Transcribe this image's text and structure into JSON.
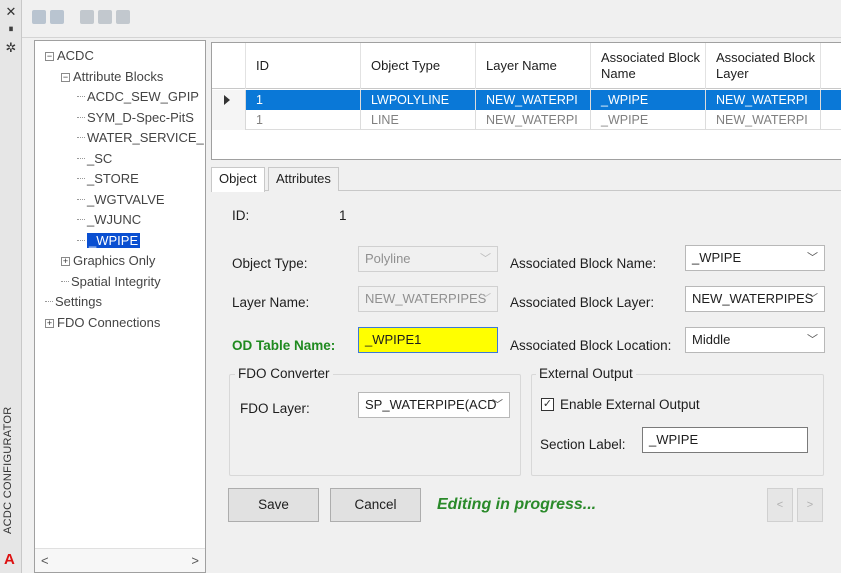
{
  "palette": {
    "title": "ACDC CONFIGURATOR",
    "close_glyph": "✕",
    "pin_glyph": "⏸",
    "settings_glyph": "✲"
  },
  "tree": {
    "items": [
      {
        "label": "ACDC",
        "expander": "−",
        "indent": 0
      },
      {
        "label": "Attribute Blocks",
        "expander": "−",
        "indent": 1
      },
      {
        "label": "ACDC_SEW_GPIP",
        "indent": 2
      },
      {
        "label": "SYM_D-Spec-PitS",
        "indent": 2
      },
      {
        "label": "WATER_SERVICE_",
        "indent": 2
      },
      {
        "label": "_SC",
        "indent": 2
      },
      {
        "label": "_STORE",
        "indent": 2
      },
      {
        "label": "_WGTVALVE",
        "indent": 2
      },
      {
        "label": "_WJUNC",
        "indent": 2
      },
      {
        "label": "_WPIPE",
        "indent": 2,
        "selected": true
      },
      {
        "label": "Graphics Only",
        "expander": "+",
        "indent": 1
      },
      {
        "label": "Spatial Integrity",
        "indent": 1
      },
      {
        "label": "Settings",
        "indent": 0
      },
      {
        "label": "FDO Connections",
        "expander": "+",
        "indent": 0
      }
    ],
    "scroll_left": "<",
    "scroll_right": ">"
  },
  "grid": {
    "headers": [
      "ID",
      "Object Type",
      "Layer Name",
      "Associated Block Name",
      "Associated Block Layer"
    ],
    "rows": [
      [
        "1",
        "LWPOLYLINE",
        "NEW_WATERPI",
        "_WPIPE",
        "NEW_WATERPI"
      ],
      [
        "1",
        "LINE",
        "NEW_WATERPI",
        "_WPIPE",
        "NEW_WATERPI"
      ]
    ]
  },
  "tabs": [
    "Object",
    "Attributes"
  ],
  "form": {
    "id_label": "ID:",
    "id_value": "1",
    "object_type_label": "Object Type:",
    "object_type_value": "Polyline",
    "layer_name_label": "Layer Name:",
    "layer_name_value": "NEW_WATERPIPES",
    "od_table_label": "OD Table Name:",
    "od_table_value": "_WPIPE1",
    "assoc_block_name_label": "Associated Block Name:",
    "assoc_block_name_value": "_WPIPE",
    "assoc_block_layer_label": "Associated Block Layer:",
    "assoc_block_layer_value": "NEW_WATERPIPES",
    "assoc_block_location_label": "Associated Block Location:",
    "assoc_block_location_value": "Middle",
    "fdo_group_title": "FDO Converter",
    "fdo_layer_label": "FDO Layer:",
    "fdo_layer_value": "SP_WATERPIPE(ACD",
    "ext_group_title": "External Output",
    "enable_ext_label": "Enable External Output",
    "enable_ext_checked": "✓",
    "section_label": "Section Label:",
    "section_value": "_WPIPE",
    "save_label": "Save",
    "cancel_label": "Cancel",
    "status_text": "Editing in progress...",
    "prev_glyph": "<",
    "next_glyph": ">"
  }
}
